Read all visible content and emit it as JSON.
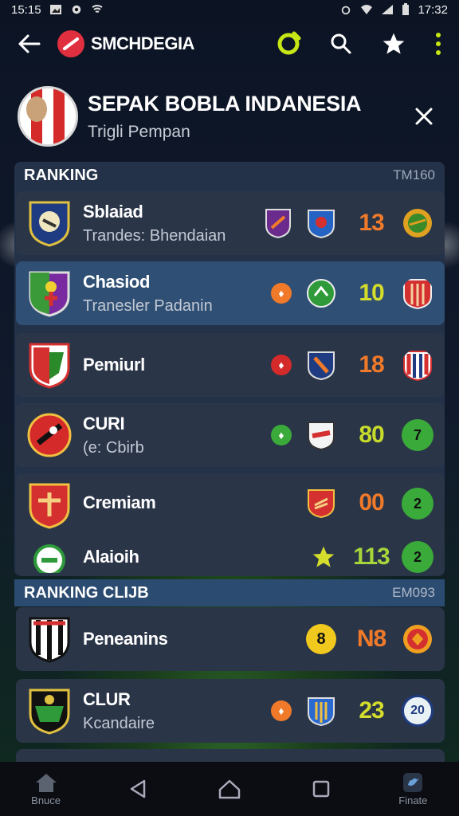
{
  "status_bar": {
    "time_left": "15:15",
    "time_right": "17:32"
  },
  "app_bar": {
    "brand_name": "SMCHDEGIA"
  },
  "header": {
    "title": "SEPAK BOBLA INDANESIA",
    "subtitle": "Trigli Pempan"
  },
  "ranking": {
    "label": "RANKING",
    "code": "TM160"
  },
  "rows": [
    {
      "name": "Sblaiad",
      "sub": "Trandes: Bhendaian",
      "score": "13",
      "score_color": "#f07a2a"
    },
    {
      "name": "Chasiod",
      "sub": "Tranesler Padanin",
      "score": "10",
      "score_color": "#d4dc2c",
      "dot": "♦"
    },
    {
      "name": "Pemiurl",
      "sub": "",
      "score": "18",
      "score_color": "#f07a2a",
      "dot": "♦"
    },
    {
      "name": "CURI",
      "sub": "(e: Cbirb",
      "score": "80",
      "score_color": "#c7dc2a",
      "dot": "♦",
      "badge": "7"
    },
    {
      "name": "Cremiam",
      "sub": "",
      "score": "00",
      "score_color": "#f07a2a",
      "badge": "2"
    },
    {
      "name": "Alaioih",
      "sub": "",
      "score": "113",
      "score_color": "#a6d63a",
      "badge": "2"
    }
  ],
  "ranking_club": {
    "label": "RANKING CLIJB",
    "code": "EM093"
  },
  "club_rows": [
    {
      "name": "Peneanins",
      "sub": "",
      "score": "N8",
      "score_color": "#f07a2a",
      "dot": "8"
    },
    {
      "name": "CLUR",
      "sub": "Kcandaire",
      "score": "23",
      "score_color": "#d4dc2c",
      "dot": "♦",
      "badge": "20"
    }
  ],
  "nav": {
    "home_label": "Bnuce",
    "right_label": "Finate"
  },
  "colors": {
    "accent_green": "#b9e61e",
    "highlight_row": "#2f4f74",
    "brand_red": "#e03040"
  }
}
